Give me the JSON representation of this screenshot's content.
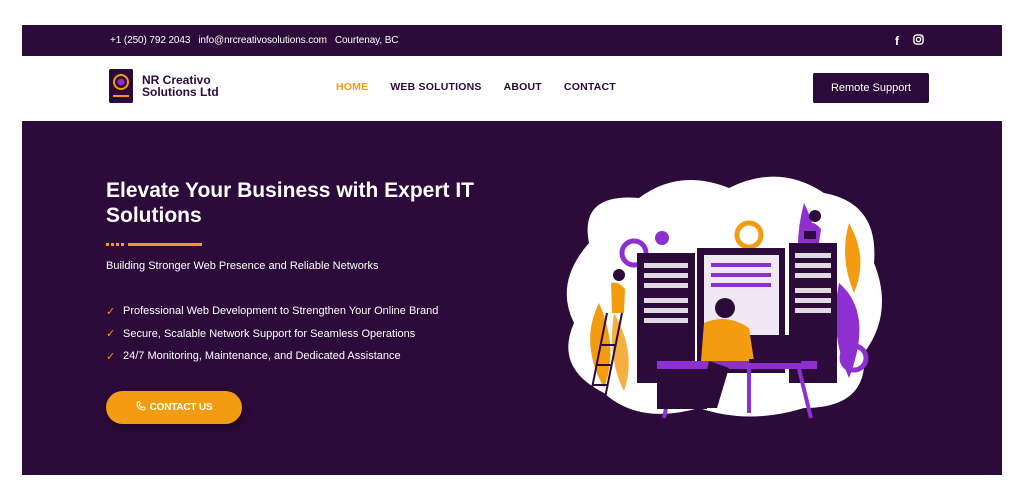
{
  "topbar": {
    "phone": "+1 (250) 792 2043",
    "email": "info@nrcreativosolutions.com",
    "location": "Courtenay, BC",
    "social_icons": [
      "facebook-icon",
      "instagram-icon"
    ],
    "facebook_glyph": "f"
  },
  "header": {
    "logo_line1": "NR Creativo",
    "logo_line2": "Solutions Ltd",
    "nav": [
      {
        "label": "HOME",
        "active": true
      },
      {
        "label": "WEB SOLUTIONS",
        "active": false
      },
      {
        "label": "ABOUT",
        "active": false
      },
      {
        "label": "CONTACT",
        "active": false
      }
    ],
    "remote_support_label": "Remote Support"
  },
  "hero": {
    "headline": "Elevate Your Business with Expert IT Solutions",
    "subtitle": "Building Stronger Web Presence and Reliable Networks",
    "features": [
      "Professional Web Development to Strengthen Your Online Brand",
      "Secure, Scalable Network Support for Seamless Operations",
      "24/7 Monitoring, Maintenance, and Dedicated Assistance"
    ],
    "cta_label": "CONTACT US"
  },
  "colors": {
    "brand_purple": "#2c0a3a",
    "accent_orange": "#f39c12",
    "illustration_purple": "#8e2fd0"
  }
}
